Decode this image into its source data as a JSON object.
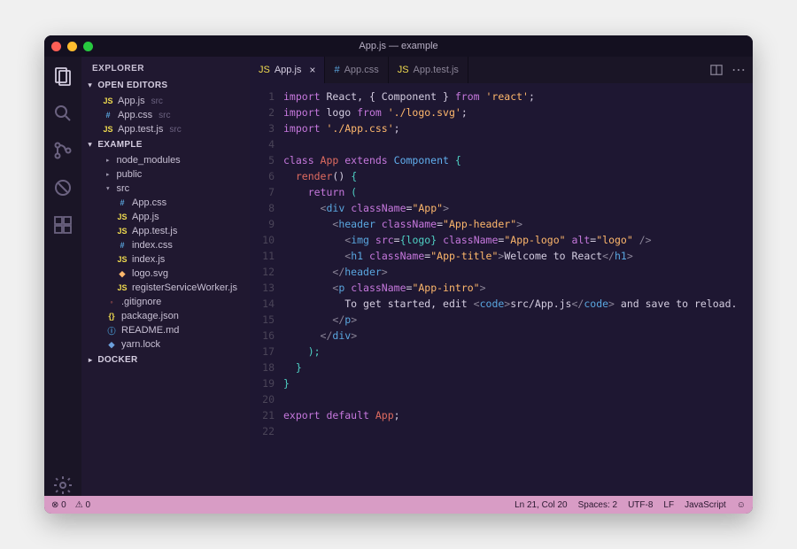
{
  "window": {
    "title": "App.js — example"
  },
  "sidebar": {
    "title": "EXPLORER",
    "openEditors": {
      "label": "OPEN EDITORS",
      "items": [
        {
          "icon": "JS",
          "name": "App.js",
          "hint": "src"
        },
        {
          "icon": "#",
          "name": "App.css",
          "hint": "src"
        },
        {
          "icon": "JS",
          "name": "App.test.js",
          "hint": "src"
        }
      ]
    },
    "project": {
      "label": "EXAMPLE",
      "folders": {
        "node_modules": "node_modules",
        "public": "public",
        "src": "src"
      },
      "srcFiles": [
        {
          "icon": "#",
          "cls": "css",
          "name": "App.css"
        },
        {
          "icon": "JS",
          "cls": "js",
          "name": "App.js"
        },
        {
          "icon": "JS",
          "cls": "js",
          "name": "App.test.js"
        },
        {
          "icon": "#",
          "cls": "css",
          "name": "index.css"
        },
        {
          "icon": "JS",
          "cls": "js",
          "name": "index.js"
        },
        {
          "icon": "◆",
          "cls": "svg",
          "name": "logo.svg"
        },
        {
          "icon": "JS",
          "cls": "js",
          "name": "registerServiceWorker.js"
        }
      ],
      "rootFiles": [
        {
          "icon": "◦",
          "cls": "git",
          "name": ".gitignore"
        },
        {
          "icon": "{}",
          "cls": "json",
          "name": "package.json"
        },
        {
          "icon": "ⓘ",
          "cls": "md",
          "name": "README.md"
        },
        {
          "icon": "◆",
          "cls": "yarn",
          "name": "yarn.lock"
        }
      ]
    },
    "docker": {
      "label": "DOCKER"
    }
  },
  "tabs": [
    {
      "icon": "JS",
      "cls": "js",
      "label": "App.js",
      "active": true,
      "close": "×"
    },
    {
      "icon": "#",
      "cls": "css",
      "label": "App.css",
      "active": false
    },
    {
      "icon": "JS",
      "cls": "js",
      "label": "App.test.js",
      "active": false
    }
  ],
  "code": {
    "lineCount": 22,
    "l1_import": "import",
    "l1_react": " React",
    "l1_comp": ", { Component } ",
    "l1_from": "from ",
    "l1_str": "'react'",
    "l1_semi": ";",
    "l2_import": "import",
    "l2_logo": " logo ",
    "l2_from": "from ",
    "l2_str": "'./logo.svg'",
    "l2_semi": ";",
    "l3_import": "import ",
    "l3_str": "'./App.css'",
    "l3_semi": ";",
    "l5_class": "class ",
    "l5_app": "App ",
    "l5_ext": "extends ",
    "l5_comp": "Component ",
    "l5_br": "{",
    "l6_sp": "  ",
    "l6_render": "render",
    "l6_par": "() ",
    "l6_br": "{",
    "l7_sp": "    ",
    "l7_return": "return ",
    "l7_par": "(",
    "l8_sp": "      ",
    "l8_lt": "<",
    "l8_div": "div ",
    "l8_attr": "className",
    "l8_eq": "=",
    "l8_str": "\"App\"",
    "l8_gt": ">",
    "l9_sp": "        ",
    "l9_lt": "<",
    "l9_tag": "header ",
    "l9_attr": "className",
    "l9_eq": "=",
    "l9_str": "\"App-header\"",
    "l9_gt": ">",
    "l10_sp": "          ",
    "l10_lt": "<",
    "l10_tag": "img ",
    "l10_a1": "src",
    "l10_eq1": "=",
    "l10_br1": "{logo}",
    "l10_a2": " className",
    "l10_eq2": "=",
    "l10_s2": "\"App-logo\"",
    "l10_a3": " alt",
    "l10_eq3": "=",
    "l10_s3": "\"logo\"",
    "l10_end": " />",
    "l11_sp": "          ",
    "l11_lt": "<",
    "l11_tag": "h1 ",
    "l11_attr": "className",
    "l11_eq": "=",
    "l11_str": "\"App-title\"",
    "l11_gt": ">",
    "l11_txt": "Welcome to React",
    "l11_ct": "</",
    "l11_ctag": "h1",
    "l11_cgt": ">",
    "l12_sp": "        ",
    "l12_ct": "</",
    "l12_tag": "header",
    "l12_gt": ">",
    "l13_sp": "        ",
    "l13_lt": "<",
    "l13_tag": "p ",
    "l13_attr": "className",
    "l13_eq": "=",
    "l13_str": "\"App-intro\"",
    "l13_gt": ">",
    "l14_sp": "          ",
    "l14_txt1": "To get started, edit ",
    "l14_lt": "<",
    "l14_code": "code",
    "l14_gt": ">",
    "l14_path": "src/App.js",
    "l14_ct": "</",
    "l14_code2": "code",
    "l14_cgt": ">",
    "l14_txt2": " and save to reload.",
    "l15_sp": "        ",
    "l15_ct": "</",
    "l15_tag": "p",
    "l15_gt": ">",
    "l16_sp": "      ",
    "l16_ct": "</",
    "l16_tag": "div",
    "l16_gt": ">",
    "l17_sp": "    ",
    "l17_par": ");",
    "l18_sp": "  ",
    "l18_br": "}",
    "l19_br": "}",
    "l21_exp": "export ",
    "l21_def": "default ",
    "l21_app": "App",
    "l21_semi": ";"
  },
  "status": {
    "errors": "0",
    "warnings": "0",
    "cursor": "Ln 21, Col 20",
    "spaces": "Spaces: 2",
    "encoding": "UTF-8",
    "eol": "LF",
    "lang": "JavaScript"
  }
}
